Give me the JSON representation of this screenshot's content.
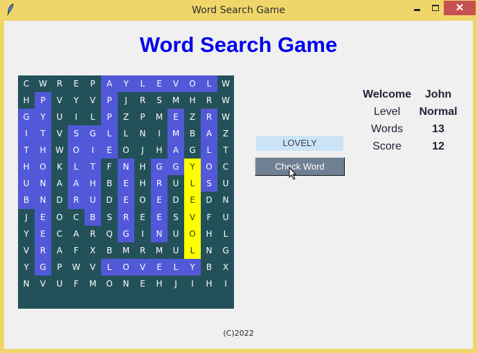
{
  "window": {
    "title": "Word Search Game",
    "close_glyph": "✕"
  },
  "heading": "Word Search Game",
  "grid": {
    "rows": [
      [
        "C",
        "W",
        "R",
        "E",
        "P",
        "A",
        "Y",
        "L",
        "E",
        "V",
        "O",
        "L",
        "W"
      ],
      [
        "H",
        "P",
        "V",
        "Y",
        "V",
        "P",
        "J",
        "R",
        "S",
        "M",
        "H",
        "R",
        "W"
      ],
      [
        "G",
        "Y",
        "U",
        "I",
        "L",
        "P",
        "Z",
        "P",
        "M",
        "E",
        "Z",
        "R",
        "W"
      ],
      [
        "I",
        "T",
        "V",
        "S",
        "G",
        "L",
        "L",
        "N",
        "I",
        "M",
        "B",
        "A",
        "Z"
      ],
      [
        "T",
        "H",
        "W",
        "O",
        "I",
        "E",
        "O",
        "J",
        "H",
        "A",
        "G",
        "L",
        "T"
      ],
      [
        "H",
        "O",
        "K",
        "L",
        "T",
        "F",
        "N",
        "H",
        "G",
        "G",
        "Y",
        "O",
        "C"
      ],
      [
        "U",
        "N",
        "A",
        "A",
        "H",
        "B",
        "E",
        "H",
        "R",
        "U",
        "L",
        "S",
        "U"
      ],
      [
        "B",
        "N",
        "D",
        "R",
        "U",
        "D",
        "E",
        "O",
        "E",
        "D",
        "E",
        "D",
        "N"
      ],
      [
        "J",
        "E",
        "O",
        "C",
        "B",
        "S",
        "R",
        "E",
        "E",
        "S",
        "V",
        "F",
        "U"
      ],
      [
        "Y",
        "E",
        "C",
        "A",
        "R",
        "Q",
        "G",
        "I",
        "N",
        "U",
        "O",
        "H",
        "L"
      ],
      [
        "V",
        "R",
        "A",
        "F",
        "X",
        "B",
        "M",
        "R",
        "M",
        "U",
        "L",
        "N",
        "G"
      ],
      [
        "Y",
        "G",
        "P",
        "W",
        "V",
        "L",
        "O",
        "V",
        "E",
        "L",
        "Y",
        "B",
        "X"
      ],
      [
        "N",
        "V",
        "U",
        "F",
        "M",
        "O",
        "N",
        "E",
        "H",
        "J",
        "I",
        "H",
        "I"
      ]
    ],
    "state": [
      ".....FFFFFFF.",
      ".F...F.......",
      "FF...F...F.F.",
      "FF.FFF...F.F.",
      "FF.FFF...F.F.",
      "FF.FF.F.FFSF.",
      "FF.FF.F.F.SF.",
      "FF.FF.F.F.S..",
      ".F..F.F.F.S..",
      ".F....F.F.S..",
      ".F........S..",
      ".F...FFFFFF..",
      "............."
    ],
    "colors": {
      "background": "#23515a",
      "found": "#5259d8",
      "selected": "#ffff00"
    }
  },
  "word_entry": {
    "value": "LOVELY"
  },
  "check_button": {
    "label": "Check Word"
  },
  "info": {
    "welcome_label": "Welcome",
    "player_name": "John",
    "level_label": "Level",
    "level_value": "Normal",
    "words_label": "Words",
    "words_value": "13",
    "score_label": "Score",
    "score_value": "12"
  },
  "footer": "(C)2022"
}
